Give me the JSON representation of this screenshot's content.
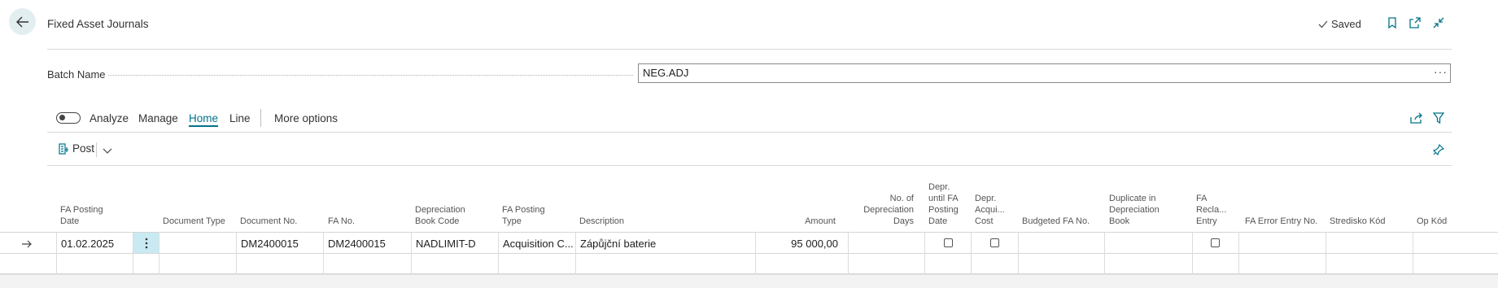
{
  "header": {
    "title": "Fixed Asset Journals",
    "saved_label": "Saved",
    "icons": [
      "back-arrow-icon",
      "checkmark-icon",
      "bookmark-icon",
      "open-new-window-icon",
      "collapse-icon"
    ]
  },
  "batch": {
    "label": "Batch Name",
    "value": "NEG.ADJ",
    "more": "···"
  },
  "actionbar": {
    "toggle_label": "Analyze",
    "tabs": [
      "Manage",
      "Home",
      "Line"
    ],
    "active_tab": "Home",
    "more_options": "More options",
    "post_label": "Post"
  },
  "columns": {
    "fa_posting_date": [
      "FA Posting",
      "Date"
    ],
    "document_type": [
      "Document Type"
    ],
    "document_no": [
      "Document No."
    ],
    "fa_no": [
      "FA No."
    ],
    "depreciation_book_code": [
      "Depreciation",
      "Book Code"
    ],
    "fa_posting_type": [
      "FA Posting",
      "Type"
    ],
    "description": [
      "Description"
    ],
    "amount": [
      "Amount"
    ],
    "no_of_depreciation_days": [
      "No. of",
      "Depreciation",
      "Days"
    ],
    "depr_until_fa_posting_date": [
      "Depr.",
      "until FA",
      "Posting",
      "Date"
    ],
    "depr_acqui_cost": [
      "Depr.",
      "Acqui...",
      "Cost"
    ],
    "budgeted_fa_no": [
      "Budgeted FA No."
    ],
    "duplicate_in_depreciation_book": [
      "Duplicate in",
      "Depreciation",
      "Book"
    ],
    "fa_recla_entry": [
      "FA",
      "Recla...",
      "Entry"
    ],
    "fa_error_entry_no": [
      "FA Error Entry No."
    ],
    "stredisko_kod": [
      "Stredisko Kód"
    ],
    "op_kod": [
      "Op Kód"
    ]
  },
  "rows": [
    {
      "fa_posting_date": "01.02.2025",
      "document_type": "",
      "document_no": "DM2400015",
      "fa_no": "DM2400015",
      "depreciation_book_code": "NADLIMIT-D",
      "fa_posting_type": "Acquisition C...",
      "description": "Zápůjční baterie",
      "amount": "95 000,00",
      "depr_until_fa_posting_date": false,
      "depr_acqui_cost": false,
      "fa_recla_entry": false
    }
  ],
  "colors": {
    "accent": "#00738a",
    "selected_cell": "#c9eaf2",
    "back_button_bg": "#e3eef1"
  }
}
